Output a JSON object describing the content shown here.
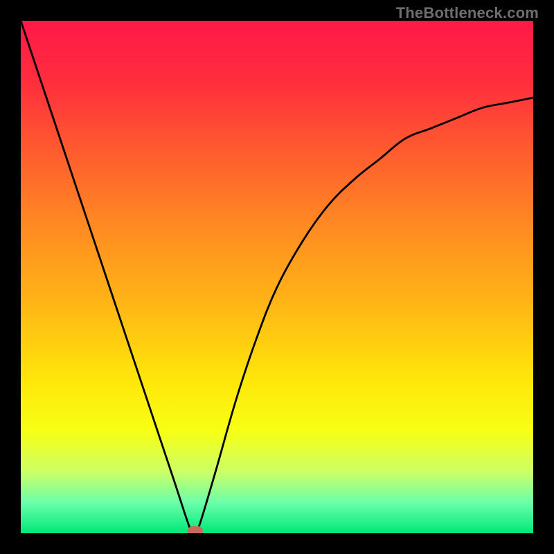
{
  "watermark": "TheBottleneck.com",
  "chart_data": {
    "type": "line",
    "title": "",
    "xlabel": "",
    "ylabel": "",
    "xlim": [
      0,
      100
    ],
    "ylim": [
      0,
      100
    ],
    "gradient_stops": [
      {
        "offset": 0,
        "color": "#ff1848"
      },
      {
        "offset": 0.12,
        "color": "#ff2e3d"
      },
      {
        "offset": 0.25,
        "color": "#ff5a2f"
      },
      {
        "offset": 0.4,
        "color": "#ff8a22"
      },
      {
        "offset": 0.55,
        "color": "#ffb515"
      },
      {
        "offset": 0.7,
        "color": "#ffe60a"
      },
      {
        "offset": 0.8,
        "color": "#f7ff14"
      },
      {
        "offset": 0.88,
        "color": "#ccff66"
      },
      {
        "offset": 0.94,
        "color": "#6bffaa"
      },
      {
        "offset": 1.0,
        "color": "#00e878"
      }
    ],
    "series": [
      {
        "name": "bottleneck-curve",
        "x": [
          0,
          5,
          10,
          15,
          20,
          25,
          30,
          33,
          34,
          35,
          38,
          42,
          46,
          50,
          55,
          60,
          65,
          70,
          75,
          80,
          85,
          90,
          95,
          100
        ],
        "values": [
          100,
          85,
          70,
          55,
          40,
          25,
          10,
          1,
          0,
          2,
          12,
          26,
          38,
          48,
          57,
          64,
          69,
          73,
          77,
          79,
          81,
          83,
          84,
          85
        ]
      }
    ],
    "marker": {
      "x": 34,
      "y": 0,
      "color": "#c96a5a"
    }
  }
}
